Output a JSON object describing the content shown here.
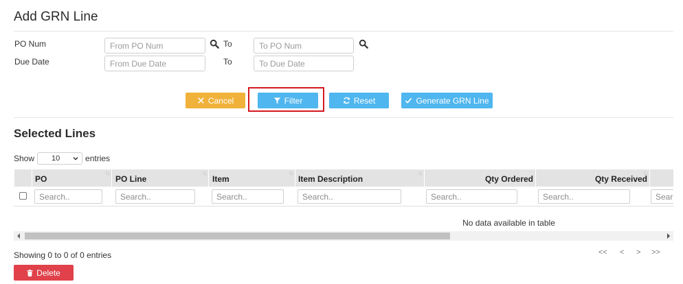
{
  "page": {
    "title": "Add GRN Line"
  },
  "form": {
    "po_num_label": "PO Num",
    "due_date_label": "Due Date",
    "to_label": "To",
    "from_po_placeholder": "From PO Num",
    "to_po_placeholder": "To PO Num",
    "from_due_placeholder": "From Due Date",
    "to_due_placeholder": "To Due Date"
  },
  "buttons": {
    "cancel": "Cancel",
    "filter": "Filter",
    "reset": "Reset",
    "generate": "Generate GRN Line",
    "delete": "Delete"
  },
  "colors": {
    "cancel": "#f0b23a",
    "primary": "#4fb6ef",
    "delete": "#e0414a",
    "highlight": "#d4181e"
  },
  "selected_lines": {
    "title": "Selected Lines",
    "show_label": "Show",
    "page_size": "10",
    "entries_label": "entries",
    "columns": [
      "PO",
      "PO Line",
      "Item",
      "Item Description",
      "Qty Ordered",
      "Qty Received"
    ],
    "search_placeholder": "Search..",
    "empty_message": "No data available in table",
    "info": "Showing 0 to 0 of 0 entries"
  },
  "pagination": {
    "first": "<<",
    "prev": "<",
    "next": ">",
    "last": ">>"
  },
  "icons": {
    "search": "magnifier-icon",
    "cancel": "x-icon",
    "filter": "funnel-icon",
    "reset": "refresh-icon",
    "generate": "check-icon",
    "delete": "trash-icon"
  }
}
